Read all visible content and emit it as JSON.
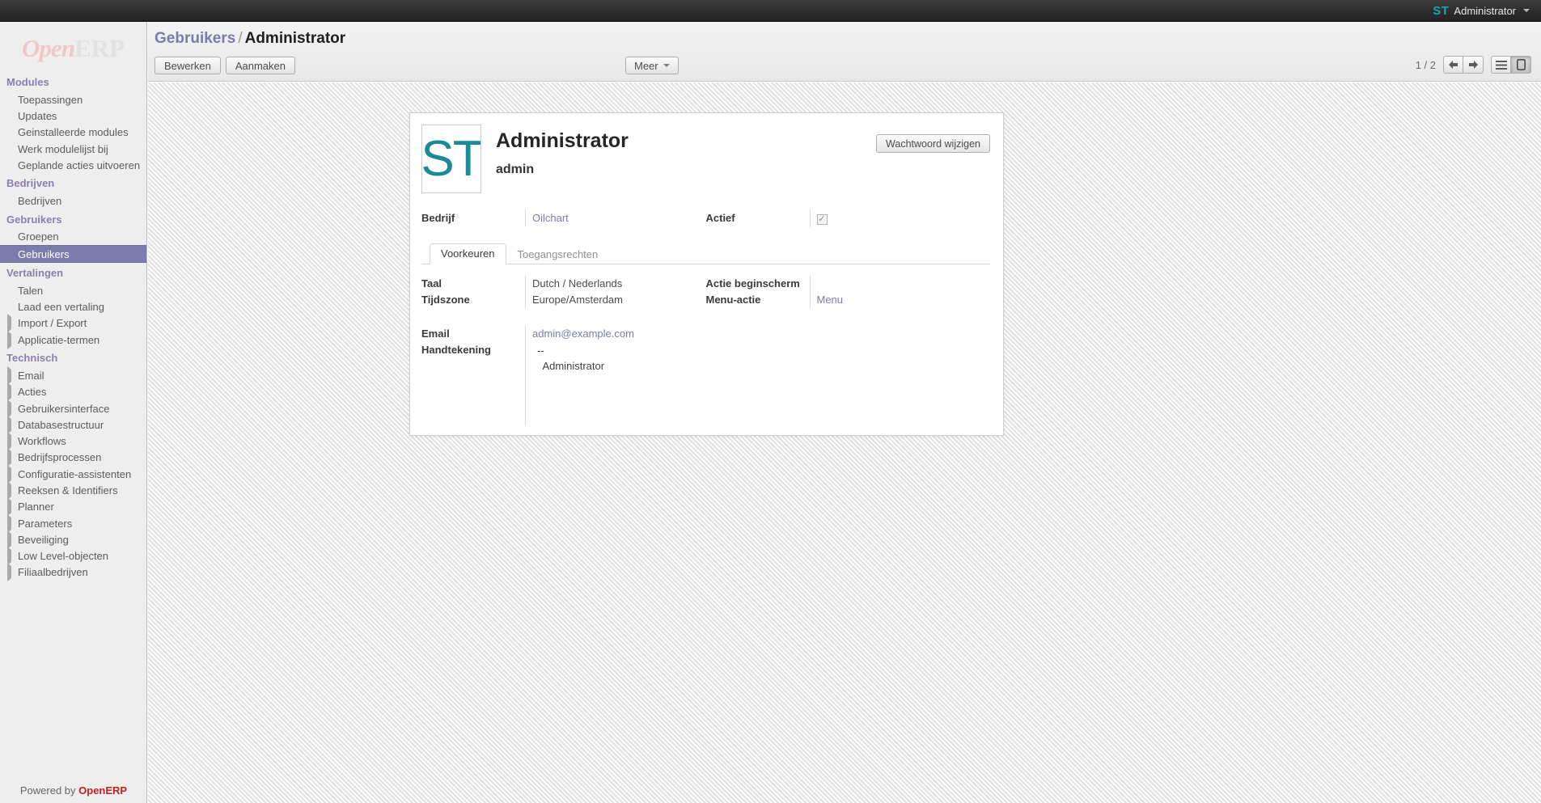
{
  "topbar": {
    "avatar_initials": "ST",
    "user_name": "Administrator",
    "caret_icon": "chevron-down-icon"
  },
  "sidebar": {
    "logo": {
      "part1": "Open",
      "part2": "ERP"
    },
    "groups": [
      {
        "title": "Modules",
        "items": [
          {
            "label": "Toepassingen",
            "expandable": false
          },
          {
            "label": "Updates",
            "expandable": false
          },
          {
            "label": "Geinstalleerde modules",
            "expandable": false
          },
          {
            "label": "Werk modulelijst bij",
            "expandable": false
          },
          {
            "label": "Geplande acties uitvoeren",
            "expandable": false
          }
        ]
      },
      {
        "title": "Bedrijven",
        "items": [
          {
            "label": "Bedrijven",
            "expandable": false
          }
        ]
      },
      {
        "title": "Gebruikers",
        "items": [
          {
            "label": "Groepen",
            "expandable": false
          },
          {
            "label": "Gebruikers",
            "expandable": false,
            "selected": true
          }
        ]
      },
      {
        "title": "Vertalingen",
        "items": [
          {
            "label": "Talen",
            "expandable": false
          },
          {
            "label": "Laad een vertaling",
            "expandable": false
          },
          {
            "label": "Import / Export",
            "expandable": true
          },
          {
            "label": "Applicatie-termen",
            "expandable": true
          }
        ]
      },
      {
        "title": "Technisch",
        "items": [
          {
            "label": "Email",
            "expandable": true
          },
          {
            "label": "Acties",
            "expandable": true
          },
          {
            "label": "Gebruikersinterface",
            "expandable": true
          },
          {
            "label": "Databasestructuur",
            "expandable": true
          },
          {
            "label": "Workflows",
            "expandable": true
          },
          {
            "label": "Bedrijfsprocessen",
            "expandable": true
          },
          {
            "label": "Configuratie-assistenten",
            "expandable": true
          },
          {
            "label": "Reeksen & Identifiers",
            "expandable": true
          },
          {
            "label": "Planner",
            "expandable": true
          },
          {
            "label": "Parameters",
            "expandable": true
          },
          {
            "label": "Beveiliging",
            "expandable": true
          },
          {
            "label": "Low Level-objecten",
            "expandable": true
          },
          {
            "label": "Filiaalbedrijven",
            "expandable": true
          }
        ]
      }
    ],
    "footer": {
      "prefix": "Powered by ",
      "brand": "OpenERP"
    }
  },
  "header": {
    "breadcrumb_root": "Gebruikers",
    "breadcrumb_separator": "/",
    "breadcrumb_current": "Administrator",
    "edit_label": "Bewerken",
    "create_label": "Aanmaken",
    "more_label": "Meer",
    "pager_text": "1 / 2",
    "prev_icon": "arrow-left-icon",
    "next_icon": "arrow-right-icon",
    "list_view_icon": "list-view-icon",
    "form_view_icon": "form-view-icon"
  },
  "record": {
    "avatar_initials": "ST",
    "title": "Administrator",
    "login": "admin",
    "change_password_label": "Wachtwoord wijzigen",
    "company_label": "Bedrijf",
    "company_value": "Oilchart",
    "active_label": "Actief",
    "active_checked": "✓"
  },
  "tabs": [
    {
      "label": "Voorkeuren",
      "active": true
    },
    {
      "label": "Toegangsrechten",
      "active": false
    }
  ],
  "preferences": {
    "language_label": "Taal",
    "language_value": "Dutch / Nederlands",
    "timezone_label": "Tijdszone",
    "timezone_value": "Europe/Amsterdam",
    "home_action_label": "Actie beginscherm",
    "home_action_value": "",
    "menu_action_label": "Menu-actie",
    "menu_action_value": "Menu",
    "email_label": "Email",
    "email_value": "admin@example.com",
    "signature_label": "Handtekening",
    "signature_value": "--\n  Administrator"
  },
  "colors": {
    "accent_purple": "#7c7bad",
    "avatar_teal": "#1c8a96",
    "brand_red": "#c02222"
  }
}
